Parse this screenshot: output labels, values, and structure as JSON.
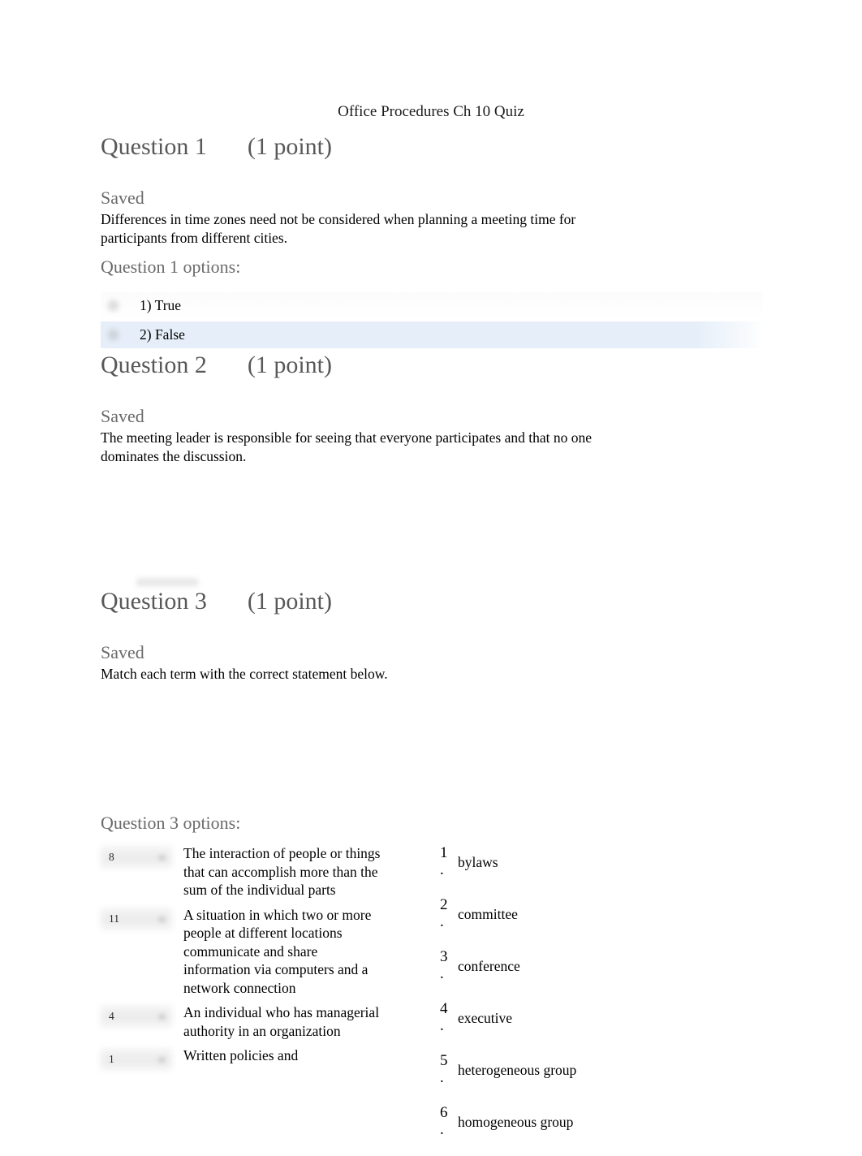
{
  "document": {
    "title": "Office Procedures Ch 10 Quiz"
  },
  "colors": {
    "selected_option_highlight": "#e6eff9",
    "heading_gray": "#585858",
    "saved_gray": "#6a6a6a",
    "body_black": "#000000"
  },
  "questions": [
    {
      "heading": "Question 1",
      "points": "(1 point)",
      "status": "Saved",
      "prompt": "Differences in time zones need not be considered when planning a meeting time for participants from different cities.",
      "options_label": "Question 1 options:",
      "options": [
        {
          "label": "1) True",
          "selected": false
        },
        {
          "label": "2) False",
          "selected": true
        }
      ]
    },
    {
      "heading": "Question 2",
      "points": "(1 point)",
      "status": "Saved",
      "prompt": "The meeting leader is responsible for seeing that everyone participates and that no one dominates the discussion."
    },
    {
      "heading": "Question 3",
      "points": "(1 point)",
      "status": "Saved",
      "prompt": "Match each term with the correct statement below.",
      "options_label": "Question 3 options:",
      "match_statements": [
        {
          "selected_value": "8",
          "statement": "The interaction of people or things that can accomplish more than the sum of the individual parts"
        },
        {
          "selected_value": "11",
          "statement": "A situation in which two or more people at different locations communicate and share information via computers and a network connection"
        },
        {
          "selected_value": "4",
          "statement": "An individual who has managerial authority in an organization"
        },
        {
          "selected_value": "1",
          "statement": "Written policies and"
        }
      ],
      "match_terms": [
        {
          "number": "1",
          "dot": ".",
          "term": "bylaws"
        },
        {
          "number": "2",
          "dot": ".",
          "term": "committee"
        },
        {
          "number": "3",
          "dot": ".",
          "term": "conference"
        },
        {
          "number": "4",
          "dot": ".",
          "term": "executive"
        },
        {
          "number": "5",
          "dot": ".",
          "term": "heterogeneous group"
        },
        {
          "number": "6",
          "dot": ".",
          "term": "homogeneous group"
        }
      ]
    }
  ]
}
